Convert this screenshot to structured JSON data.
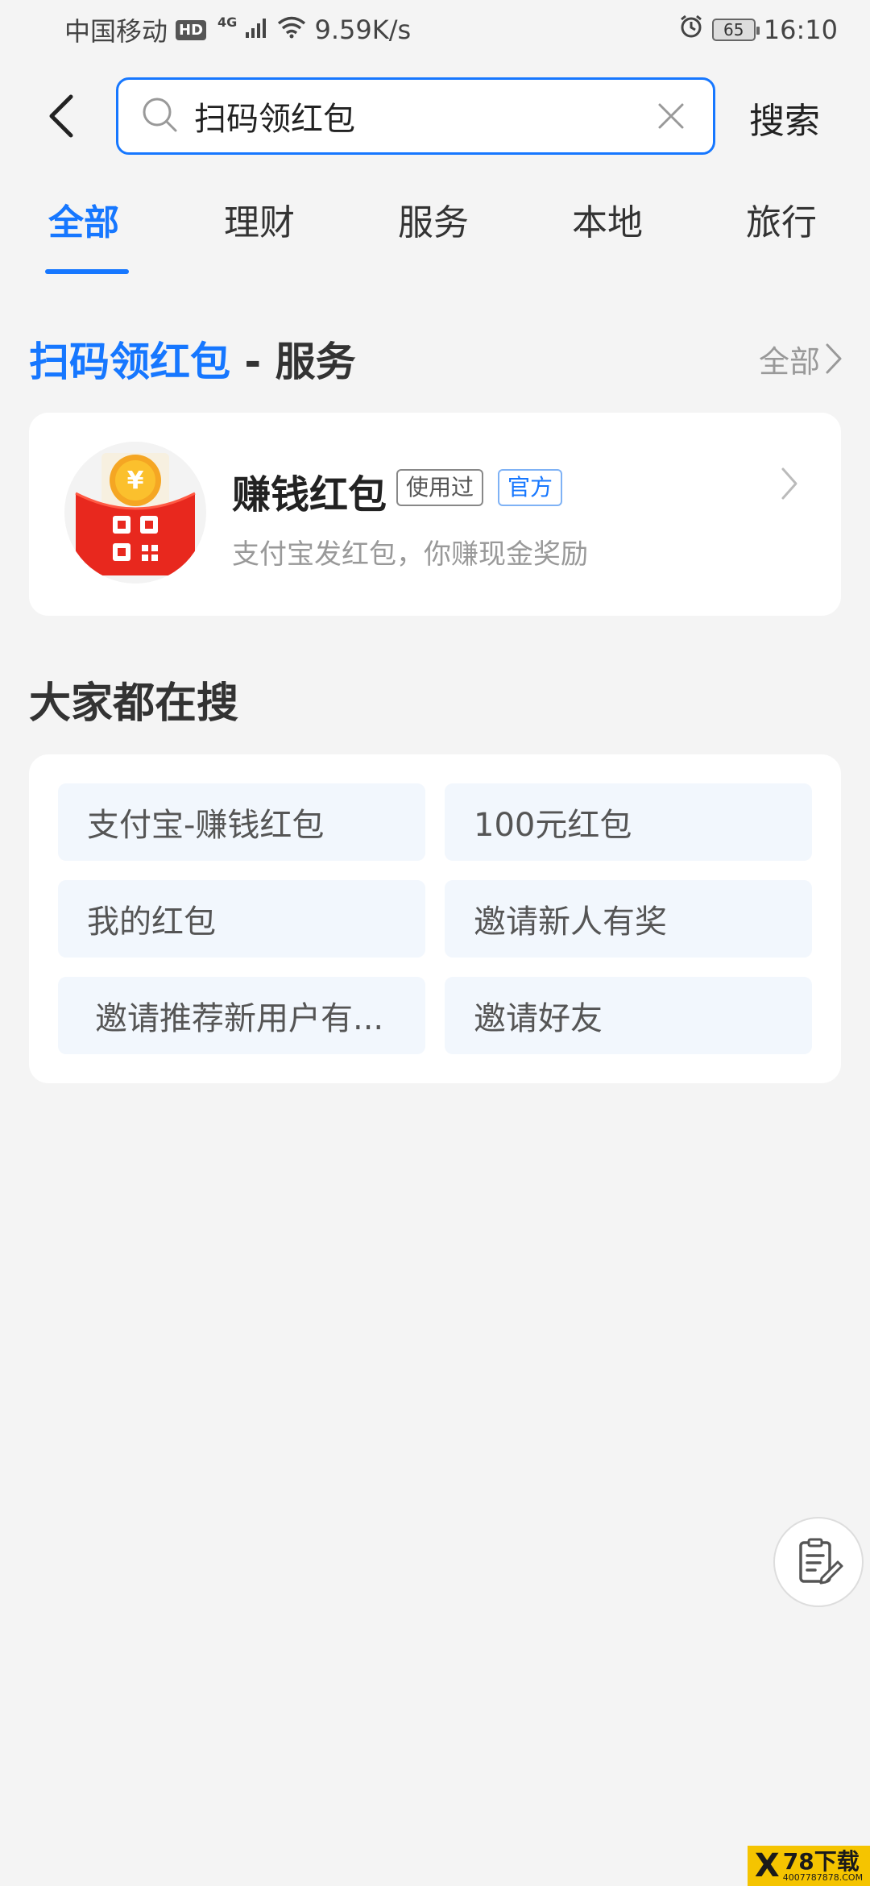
{
  "status_bar": {
    "carrier": "中国移动",
    "hd": "HD",
    "network": "4G",
    "speed": "9.59K/s",
    "battery": "65",
    "time": "16:10"
  },
  "search": {
    "query": "扫码领红包",
    "submit_label": "搜索"
  },
  "tabs": [
    {
      "label": "全部",
      "active": true
    },
    {
      "label": "理财",
      "active": false
    },
    {
      "label": "服务",
      "active": false
    },
    {
      "label": "本地",
      "active": false
    },
    {
      "label": "旅行",
      "active": false
    }
  ],
  "service_section": {
    "title_highlight": "扫码领红包",
    "title_rest": " - 服务",
    "see_all": "全部"
  },
  "service_item": {
    "name": "赚钱红包",
    "tag_used": "使用过",
    "tag_official": "官方",
    "description": "支付宝发红包，你赚现金奖励"
  },
  "popular": {
    "title": "大家都在搜",
    "chips": [
      "支付宝-赚钱红包",
      "100元红包",
      "我的红包",
      "邀请新人有奖",
      "邀请推荐新用户有...",
      "邀请好友"
    ]
  },
  "watermark": {
    "logo": "X",
    "main": "78下载",
    "sub": "4007787878.COM"
  },
  "colors": {
    "accent": "#1677ff",
    "background": "#f4f4f4",
    "chip_bg": "#f2f7fd",
    "icon_red": "#e8281e",
    "coin_gold": "#f5a623"
  }
}
